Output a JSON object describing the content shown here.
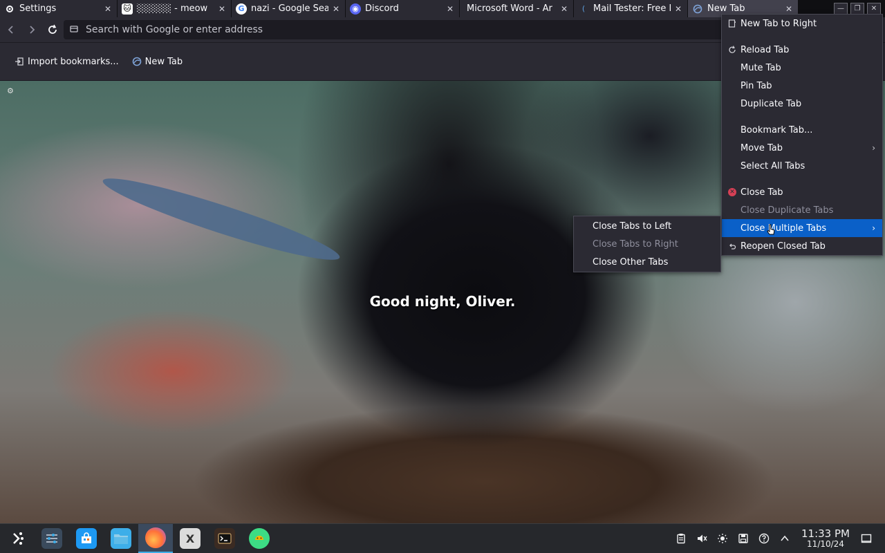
{
  "tabs": [
    {
      "title": "Settings",
      "icon": "gear-icon",
      "active": false
    },
    {
      "title": "░░░░░ - meow",
      "icon": "cat-icon",
      "active": false
    },
    {
      "title": "nazi - Google Search",
      "icon": "google-icon",
      "active": false
    },
    {
      "title": "Discord",
      "icon": "discord-icon",
      "active": false
    },
    {
      "title": "Microsoft Word - Ar",
      "icon": "",
      "active": false
    },
    {
      "title": "Mail Tester: Free E",
      "icon": "mail-tester-icon",
      "active": false
    },
    {
      "title": "New Tab",
      "icon": "firefox-tab-icon",
      "active": true
    }
  ],
  "toolbar": {
    "url_placeholder": "Search with Google or enter address"
  },
  "bookmarks": [
    {
      "label": "Import bookmarks...",
      "icon": "import-icon"
    },
    {
      "label": "New Tab",
      "icon": "firefox-tab-icon"
    }
  ],
  "content": {
    "caption": "Good night, Oliver."
  },
  "tab_menu": {
    "new_tab_right": "New Tab to Right",
    "reload": "Reload Tab",
    "mute": "Mute Tab",
    "pin": "Pin Tab",
    "duplicate": "Duplicate Tab",
    "bookmark": "Bookmark Tab...",
    "move": "Move Tab",
    "select_all": "Select All Tabs",
    "close": "Close Tab",
    "close_duplicates": "Close Duplicate Tabs",
    "close_multiple": "Close Multiple Tabs",
    "reopen": "Reopen Closed Tab"
  },
  "submenu": {
    "close_left": "Close Tabs to Left",
    "close_right": "Close Tabs to Right",
    "close_other": "Close Other Tabs"
  },
  "taskbar": {
    "time": "11:33 PM",
    "date": "11/10/24"
  },
  "colors": {
    "menu_highlight": "#0a60c8",
    "menu_bg": "#2b2a33",
    "taskbar_bg": "#26282c",
    "close_tab_icon": "#d64055"
  }
}
